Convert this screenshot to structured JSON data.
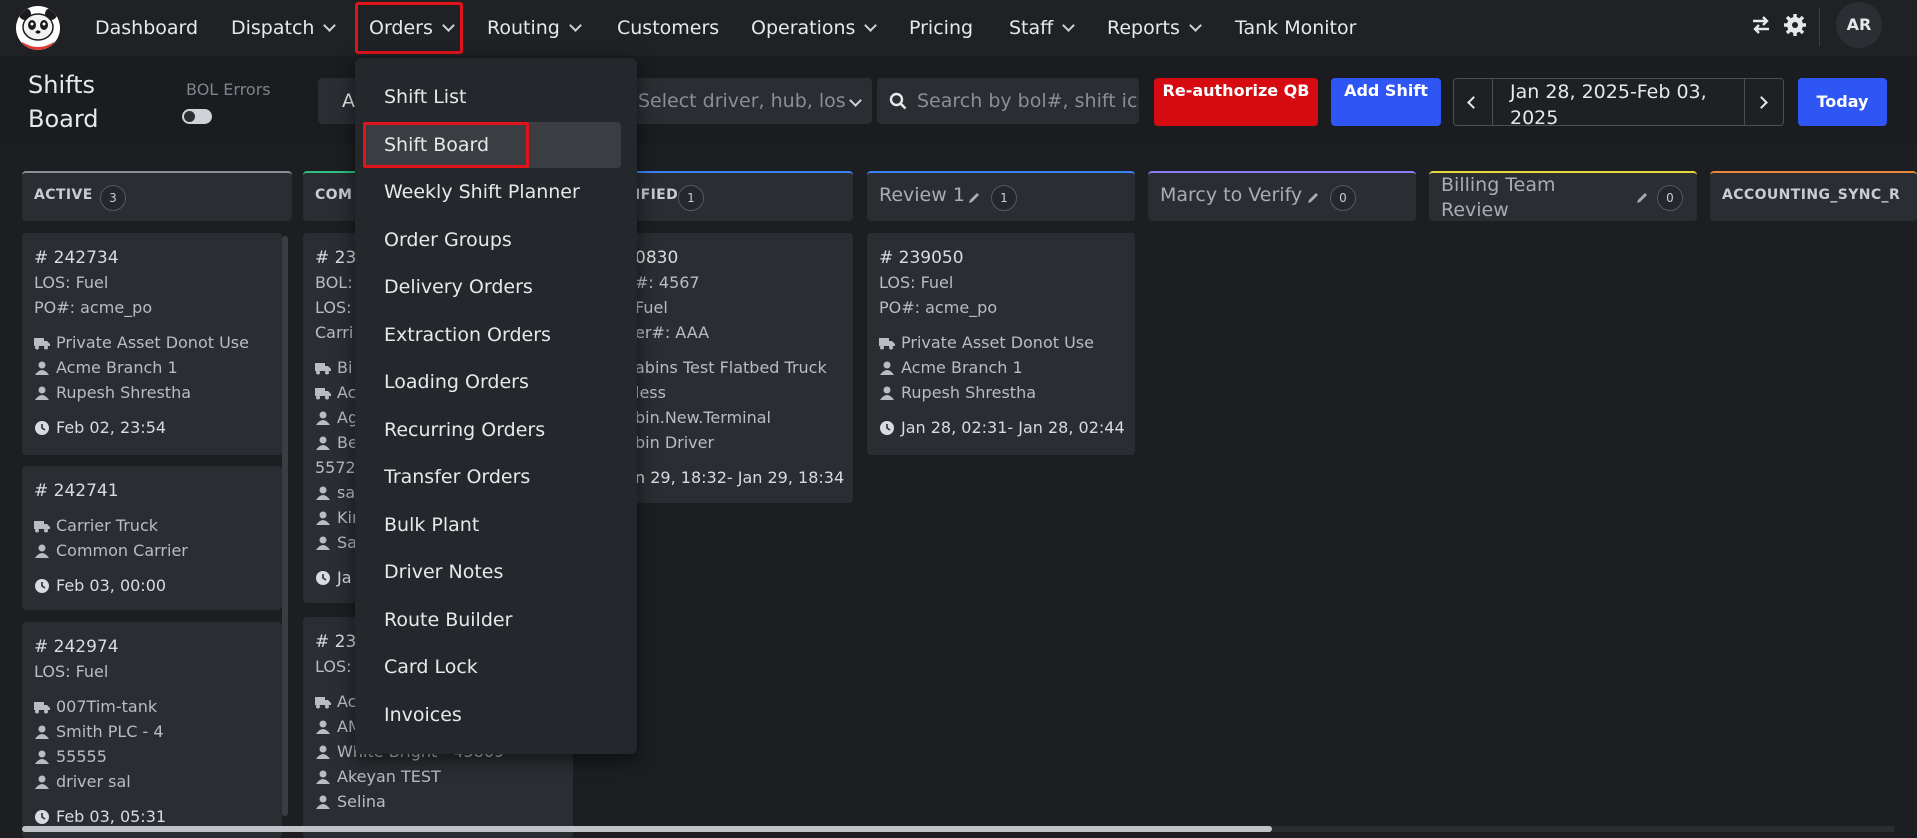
{
  "nav": {
    "items": [
      {
        "label": "Dashboard"
      },
      {
        "label": "Dispatch"
      },
      {
        "label": "Orders"
      },
      {
        "label": "Routing"
      },
      {
        "label": "Customers"
      },
      {
        "label": "Operations"
      },
      {
        "label": "Pricing"
      },
      {
        "label": "Staff"
      },
      {
        "label": "Reports"
      },
      {
        "label": "Tank Monitor"
      }
    ],
    "avatar_initials": "AR",
    "icons": [
      "swap-icon",
      "gear-icon"
    ]
  },
  "toolbar": {
    "page_title": "Shifts Board",
    "bol_errors_label": "BOL Errors",
    "filter_a": "A",
    "driver_placeholder": "Select driver, hub, los",
    "search_placeholder": "Search by bol#, shift ic",
    "reauthorize_label": "Re-authorize QB",
    "add_shift_label": "Add Shift",
    "date_range": "Jan 28, 2025-Feb 03, 2025",
    "today_label": "Today"
  },
  "dropdown": {
    "items": [
      "Shift List",
      "Shift Board",
      "Weekly Shift Planner",
      "Order Groups",
      "Delivery Orders",
      "Extraction Orders",
      "Loading Orders",
      "Recurring Orders",
      "Transfer Orders",
      "Bulk Plant",
      "Driver Notes",
      "Route Builder",
      "Card Lock",
      "Invoices"
    ],
    "selected": "Shift Board"
  },
  "columns": [
    {
      "title": "ACTIVE",
      "count": "3",
      "color": "#8b9097"
    },
    {
      "title": "COM",
      "count": "",
      "color": "#2ec27e"
    },
    {
      "title": "IFIED",
      "count": "1",
      "color": "#3b82f6"
    },
    {
      "title": "Review 1",
      "count": "1",
      "color": "#3b82f6"
    },
    {
      "title": "Marcy to Verify",
      "count": "0",
      "color": "#8b7cf6"
    },
    {
      "title": "Billing Team Review",
      "count": "0",
      "color": "#e5d83a"
    },
    {
      "title": "ACCOUNTING_SYNC_R",
      "count": "",
      "color": "#e8893a"
    }
  ],
  "cards": {
    "active": [
      {
        "id": "# 242734",
        "los": "LOS: Fuel",
        "po": "PO#: acme_po",
        "asset": "Private Asset Donot Use",
        "branch": "Acme Branch 1",
        "driver": "Rupesh Shrestha",
        "time": "Feb 02, 23:54"
      },
      {
        "id": "# 242741",
        "asset": "Carrier Truck",
        "branch": "Common Carrier",
        "time": "Feb 03, 00:00"
      },
      {
        "id": "# 242974",
        "los": "LOS: Fuel",
        "asset": "007Tim-tank",
        "branch": "Smith PLC - 4",
        "phone": "55555",
        "driver": "driver sal",
        "time": "Feb 03, 05:31"
      }
    ],
    "completed": [
      {
        "lines": [
          "# 23",
          "BOL:",
          "LOS:",
          "Carri",
          "Bi",
          "Ac",
          "Ag",
          "Be",
          "5572",
          "sal",
          "Kir",
          "Sa",
          "Ja"
        ]
      },
      {
        "lines": [
          "# 23",
          "LOS:",
          "Ac",
          "AM",
          "White-Bright - 43869",
          "Akeyan TEST",
          "Selina"
        ]
      }
    ],
    "verified": {
      "lines": [
        "0830",
        "#: 4567",
        "Fuel",
        "er#: AAA",
        "abins Test Flatbed Truck",
        "less",
        "bin.New.Terminal",
        "bin Driver",
        "n 29, 18:32- Jan 29, 18:34"
      ]
    },
    "review": {
      "id": "# 239050",
      "los": "LOS: Fuel",
      "po": "PO#: acme_po",
      "asset": "Private Asset Donot Use",
      "branch": "Acme Branch 1",
      "driver": "Rupesh Shrestha",
      "time": "Jan 28, 02:31- Jan 28, 02:44"
    }
  }
}
